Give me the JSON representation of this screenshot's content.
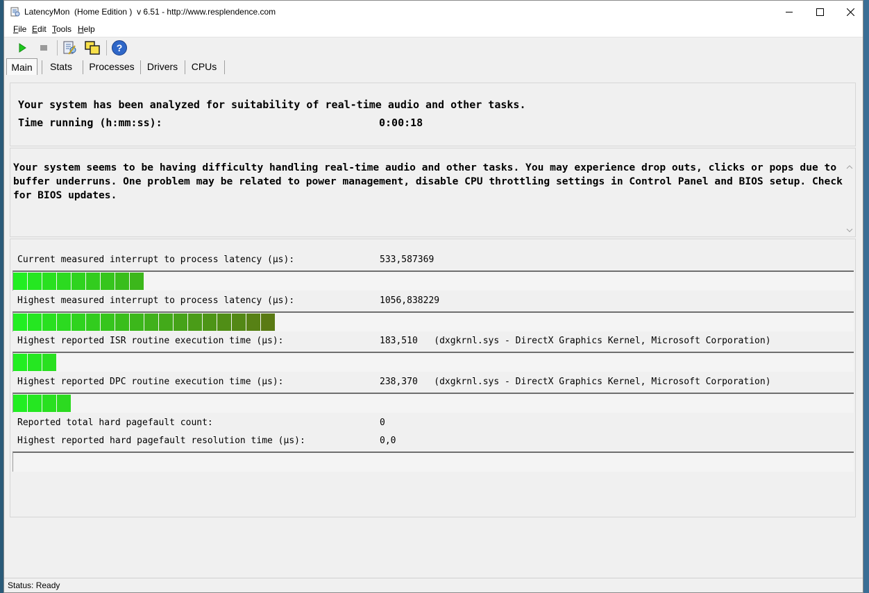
{
  "window": {
    "title": "LatencyMon  (Home Edition )  v 6.51 - http://www.resplendence.com"
  },
  "menu": [
    "File",
    "Edit",
    "Tools",
    "Help"
  ],
  "toolbar": {
    "icons": [
      "play-icon",
      "stop-icon",
      "report-icon",
      "windows-icon",
      "help-icon"
    ]
  },
  "tabs": [
    "Main",
    "Stats",
    "Processes",
    "Drivers",
    "CPUs"
  ],
  "main": {
    "intro": "Your system has been analyzed for suitability of real-time audio and other tasks.",
    "time_label": "Time running (h:mm:ss):",
    "time_value": "0:00:18",
    "conclusion": "Your system seems to be having difficulty handling real-time audio and other tasks. You may experience drop outs, clicks or pops due to buffer underruns. One problem may be related to power management, disable CPU throttling settings in Control Panel and BIOS setup. Check for BIOS updates.",
    "metrics": [
      {
        "label": "Current measured interrupt to process latency (µs):",
        "value": "533,587369",
        "bar_segments": 9
      },
      {
        "label": "Highest measured interrupt to process latency (µs):",
        "value": "1056,838229",
        "bar_segments": 18
      },
      {
        "label": "Highest reported ISR routine execution time (µs):",
        "value": "183,510   (dxgkrnl.sys - DirectX Graphics Kernel, Microsoft Corporation)",
        "bar_segments": 3
      },
      {
        "label": "Highest reported DPC routine execution time (µs):",
        "value": "238,370   (dxgkrnl.sys - DirectX Graphics Kernel, Microsoft Corporation)",
        "bar_segments": 4
      },
      {
        "label": "Reported total hard pagefault count:",
        "value": "0"
      },
      {
        "label": "Highest reported hard pagefault resolution time (µs):",
        "value": "0,0",
        "bar_segments": 0
      }
    ]
  },
  "colors": {
    "bar_green_bright": "#22ee22",
    "bar_green_dark": "#5a7a14"
  },
  "status": "Status: Ready"
}
